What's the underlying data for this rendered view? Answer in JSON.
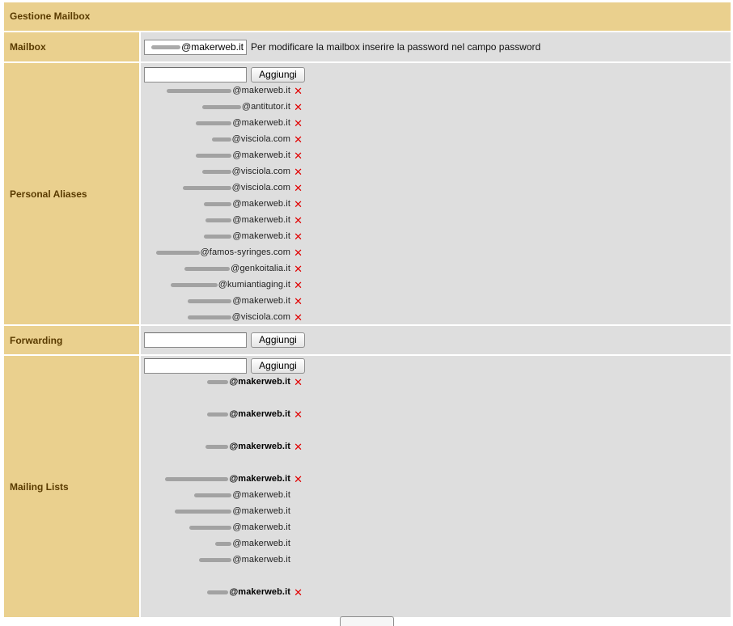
{
  "header": {
    "title": "Gestione Mailbox"
  },
  "mailbox": {
    "label": "Mailbox",
    "value": "@makerweb.it",
    "help": "Per modificare la mailbox inserire la password nel campo password"
  },
  "aliases": {
    "label": "Personal Aliases",
    "input_value": "",
    "button": "Aggiungi",
    "items": [
      {
        "domain": "@makerweb.it",
        "del": "✕"
      },
      {
        "domain": "@antitutor.it",
        "del": "✕"
      },
      {
        "domain": "@makerweb.it",
        "del": "✕"
      },
      {
        "domain": "@visciola.com",
        "del": "✕"
      },
      {
        "domain": "@makerweb.it",
        "del": "✕"
      },
      {
        "domain": "@visciola.com",
        "del": "✕"
      },
      {
        "domain": "@visciola.com",
        "del": "✕"
      },
      {
        "domain": "@makerweb.it",
        "del": "✕"
      },
      {
        "domain": "@makerweb.it",
        "del": "✕"
      },
      {
        "domain": "@makerweb.it",
        "del": "✕"
      },
      {
        "domain": "@famos-syringes.com",
        "del": "✕"
      },
      {
        "domain": "@genkoitalia.it",
        "del": "✕"
      },
      {
        "domain": "@kumiantiaging.it",
        "del": "✕"
      },
      {
        "domain": "@makerweb.it",
        "del": "✕"
      },
      {
        "domain": "@visciola.com",
        "del": "✕"
      }
    ]
  },
  "forwarding": {
    "label": "Forwarding",
    "input_value": "",
    "button": "Aggiungi"
  },
  "mailing_lists": {
    "label": "Mailing Lists",
    "input_value": "",
    "button": "Aggiungi",
    "items": [
      {
        "domain": "@makerweb.it",
        "del": "✕"
      },
      {
        "domain": "@makerweb.it",
        "del": "✕"
      },
      {
        "domain": "@makerweb.it",
        "del": "✕"
      },
      {
        "domain": "@makerweb.it",
        "del": "✕"
      },
      {
        "domain": "@makerweb.it",
        "del": ""
      },
      {
        "domain": "@makerweb.it",
        "del": ""
      },
      {
        "domain": "@makerweb.it",
        "del": ""
      },
      {
        "domain": "@makerweb.it",
        "del": ""
      },
      {
        "domain": "@makerweb.it",
        "del": ""
      },
      {
        "domain": "@makerweb.it",
        "del": "✕"
      }
    ]
  },
  "colors": {
    "label_bg": "#ead08e",
    "label_text": "#5a3b00",
    "content_bg": "#dedede",
    "delete_icon": "#e10000"
  }
}
